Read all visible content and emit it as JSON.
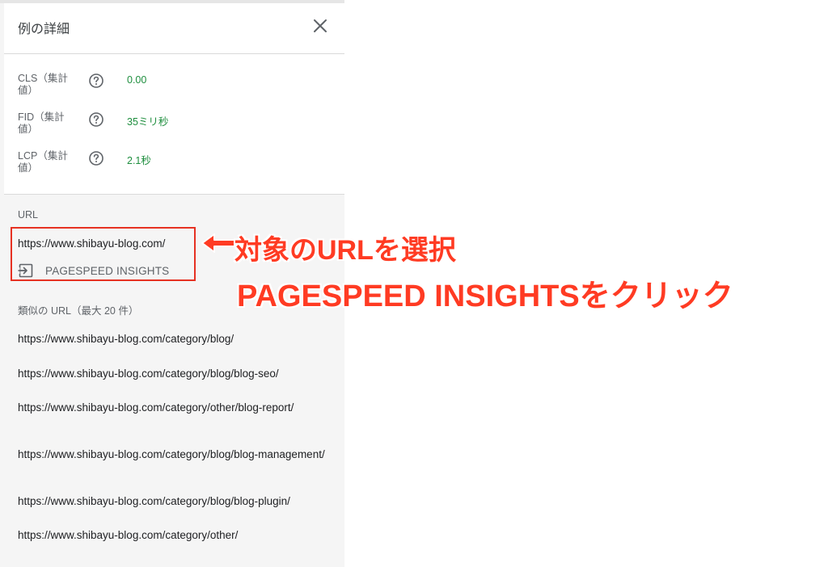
{
  "header": {
    "title": "例の詳細"
  },
  "metrics": [
    {
      "label": "CLS（集計値）",
      "value": "0.00"
    },
    {
      "label": "FID（集計値）",
      "value": "35ミリ秒"
    },
    {
      "label": "LCP（集計値）",
      "value": "2.1秒"
    }
  ],
  "url_section": {
    "label": "URL",
    "main_url": "https://www.shibayu-blog.com/",
    "psi_label": "PAGESPEED INSIGHTS",
    "similar_label": "類似の URL（最大 20 件）",
    "similar_urls": [
      "https://www.shibayu-blog.com/category/blog/",
      "https://www.shibayu-blog.com/category/blog/blog-seo/",
      "https://www.shibayu-blog.com/category/other/blog-report/",
      "https://www.shibayu-blog.com/category/blog/blog-management/",
      "https://www.shibayu-blog.com/category/blog/blog-plugin/",
      "https://www.shibayu-blog.com/category/other/"
    ]
  },
  "annotation": {
    "line1": "対象のURLを選択",
    "line2": "PAGESPEED INSIGHTSをクリック"
  },
  "colors": {
    "metric_good": "#1e8e3e",
    "annotation_red": "#ff3b23"
  }
}
